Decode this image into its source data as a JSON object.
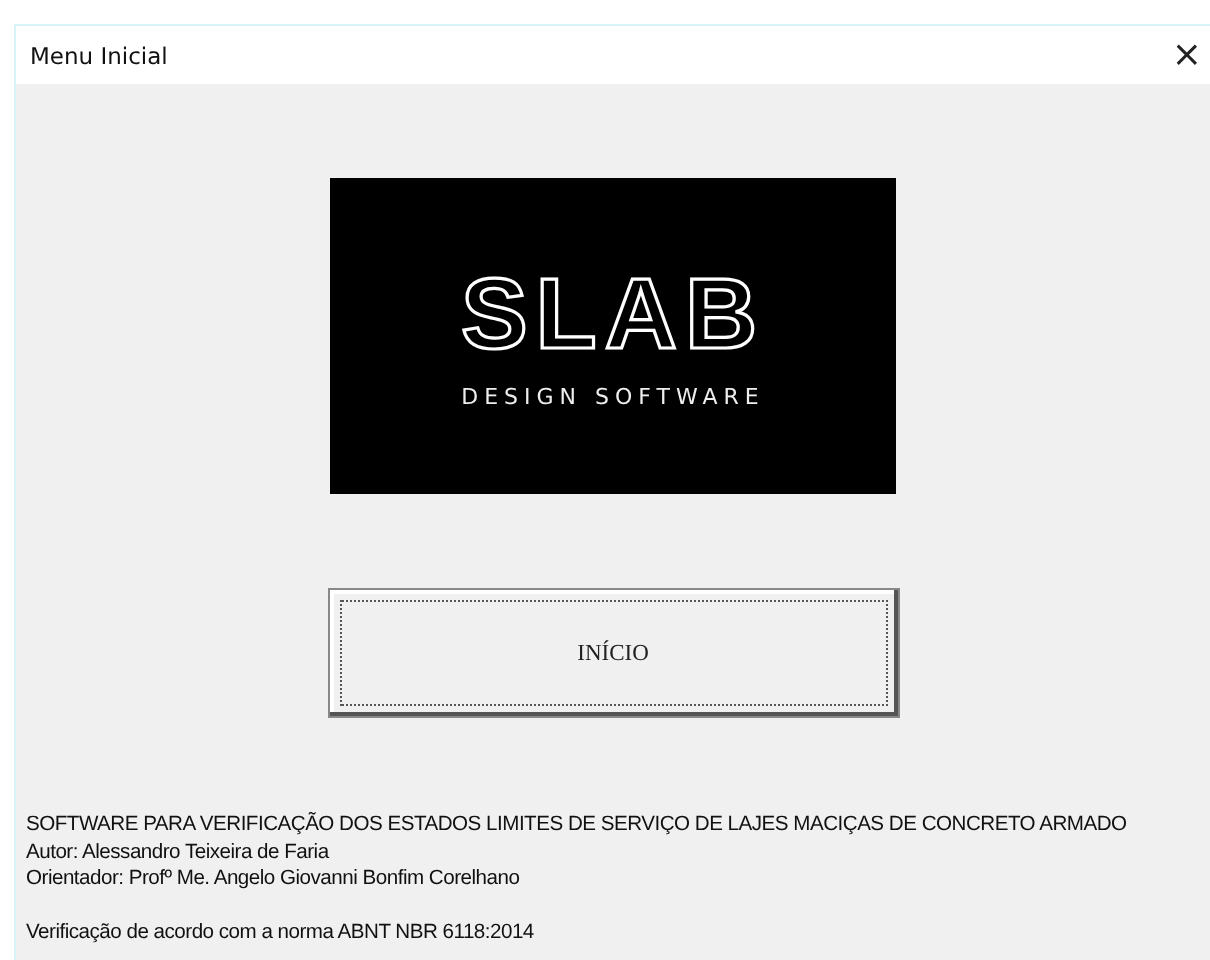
{
  "window": {
    "title": "Menu Inicial",
    "close": "×"
  },
  "logo": {
    "name": "SLAB",
    "tagline": "DESIGN SOFTWARE"
  },
  "start_button": {
    "label": "INÍCIO"
  },
  "info_lines": [
    "SOFTWARE PARA VERIFICAÇÃO DOS ESTADOS LIMITES DE SERVIÇO DE LAJES MACIÇAS DE CONCRETO ARMADO",
    "Autor: Alessandro Teixeira de Faria",
    "Orientador: Profº Me. Angelo Giovanni Bonfim Corelhano"
  ],
  "norm_line": "Verificação de acordo com a norma ABNT NBR 6118:2014"
}
